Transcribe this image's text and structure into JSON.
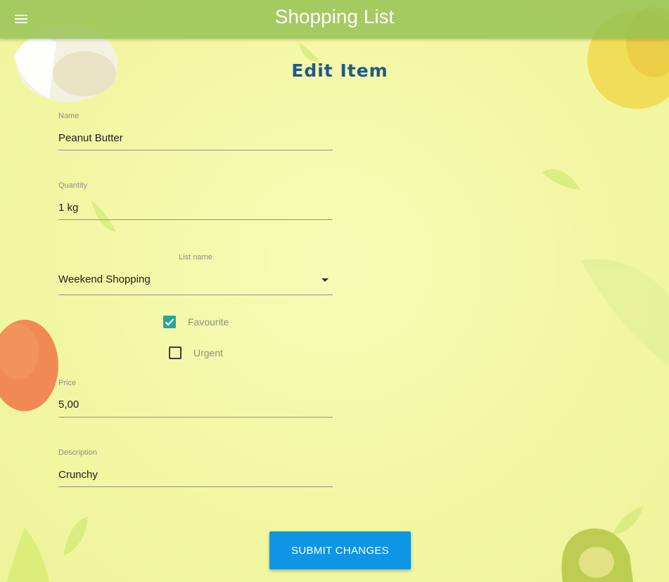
{
  "app": {
    "title": "Shopping List",
    "menu_icon": "hamburger-menu-icon"
  },
  "page": {
    "heading": "Edit Item"
  },
  "form": {
    "name": {
      "label": "Name",
      "value": "Peanut Butter"
    },
    "quantity": {
      "label": "Quantity",
      "value": "1 kg"
    },
    "list_name": {
      "label": "List name",
      "value": "Weekend Shopping",
      "icon": "dropdown-arrow-icon"
    },
    "favourite": {
      "label": "Favourite",
      "checked": true
    },
    "urgent": {
      "label": "Urgent",
      "checked": false
    },
    "price": {
      "label": "Price",
      "value": "5,00"
    },
    "description": {
      "label": "Description",
      "value": "Crunchy"
    },
    "submit_label": "SUBMIT CHANGES"
  },
  "colors": {
    "appbar": "#92c152",
    "heading": "#1d5a8a",
    "checkbox_checked": "#26a69a",
    "submit_button": "#0e95e3",
    "background": "#f3f7a4"
  }
}
